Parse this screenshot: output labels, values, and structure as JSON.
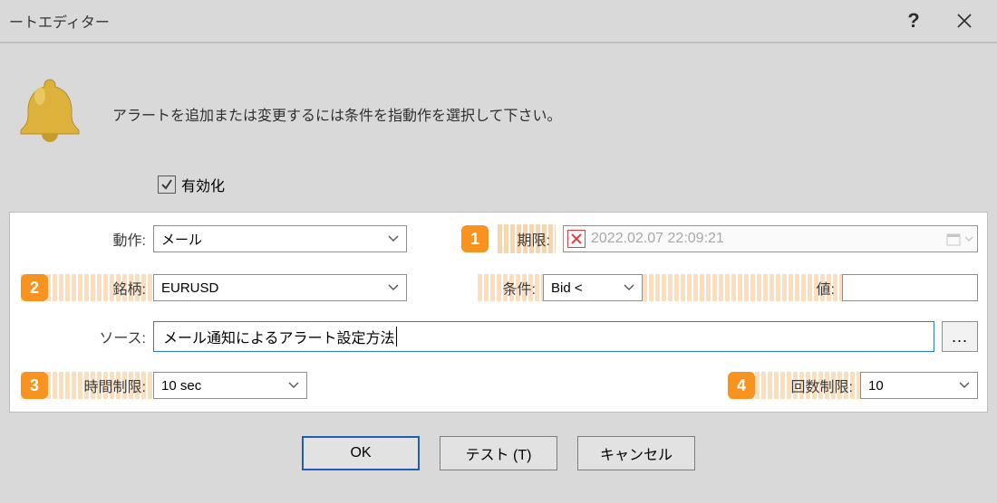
{
  "window": {
    "title": "ートエディター"
  },
  "intro": "アラートを追加または変更するには条件を指動作を選択して下さい。",
  "enable": {
    "label": "有効化"
  },
  "badges": {
    "b1": "1",
    "b2": "2",
    "b3": "3",
    "b4": "4"
  },
  "labels": {
    "action": "動作:",
    "expiry": "期限:",
    "symbol": "銘柄:",
    "condition": "条件:",
    "value": "値:",
    "source": "ソース:",
    "timeout": "時間制限:",
    "countlimit": "回数制限:"
  },
  "fields": {
    "action": "メール",
    "expiry": "2022.02.07 22:09:21",
    "symbol": "EURUSD",
    "condition": "Bid <",
    "value": "",
    "source": "メール通知によるアラート設定方法",
    "timeout": "10 sec",
    "countlimit": "10"
  },
  "buttons": {
    "ok": "OK",
    "test": "テスト (T)",
    "cancel": "キャンセル",
    "browse": "..."
  }
}
